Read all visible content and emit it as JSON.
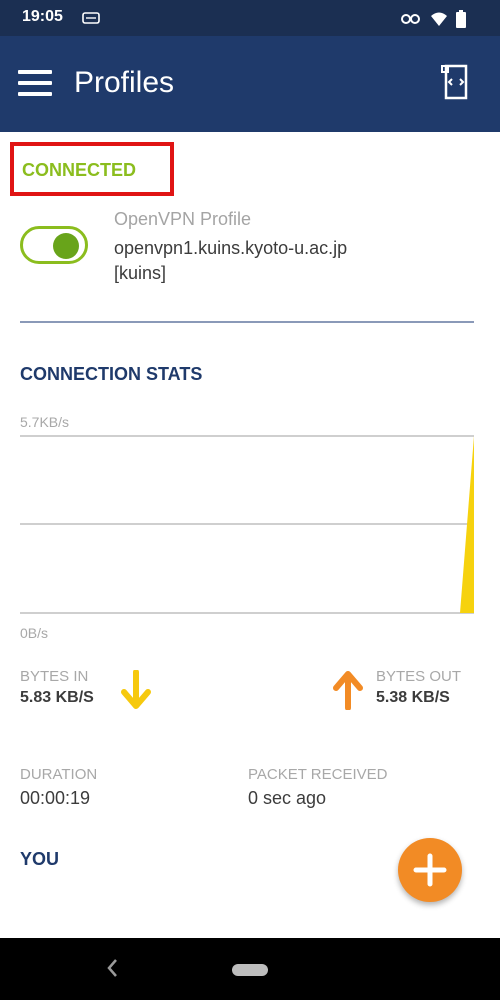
{
  "status_bar": {
    "time": "19:05"
  },
  "app_bar": {
    "title": "Profiles"
  },
  "connection": {
    "status": "CONNECTED",
    "toggle_on": true
  },
  "profile": {
    "label": "OpenVPN Profile",
    "host": "openvpn1.kuins.kyoto-u.ac.jp",
    "user": "[kuins]"
  },
  "stats": {
    "title": "CONNECTION STATS",
    "chart_max_label": "5.7KB/s",
    "chart_min_label": "0B/s",
    "bytes_in_label": "BYTES IN",
    "bytes_in_value": "5.83 KB/S",
    "bytes_out_label": "BYTES OUT",
    "bytes_out_value": "5.38 KB/S",
    "duration_label": "DURATION",
    "duration_value": "00:00:19",
    "packet_label": "PACKET RECEIVED",
    "packet_value": "0 sec ago"
  },
  "you_section": {
    "title": "YOU"
  },
  "colors": {
    "app_bar": "#1f3a6b",
    "connected": "#8bbd1e",
    "bytes_in": "#f6c90e",
    "bytes_out": "#f28b25",
    "highlight": "#e01414"
  },
  "chart_data": {
    "type": "area",
    "ylim": [
      0,
      5.7
    ],
    "series": [
      {
        "values": [
          0,
          0,
          0,
          0,
          0,
          0,
          0,
          0,
          0,
          0,
          0,
          0,
          0,
          0,
          0,
          0,
          0,
          0,
          0,
          5.7
        ]
      }
    ]
  }
}
